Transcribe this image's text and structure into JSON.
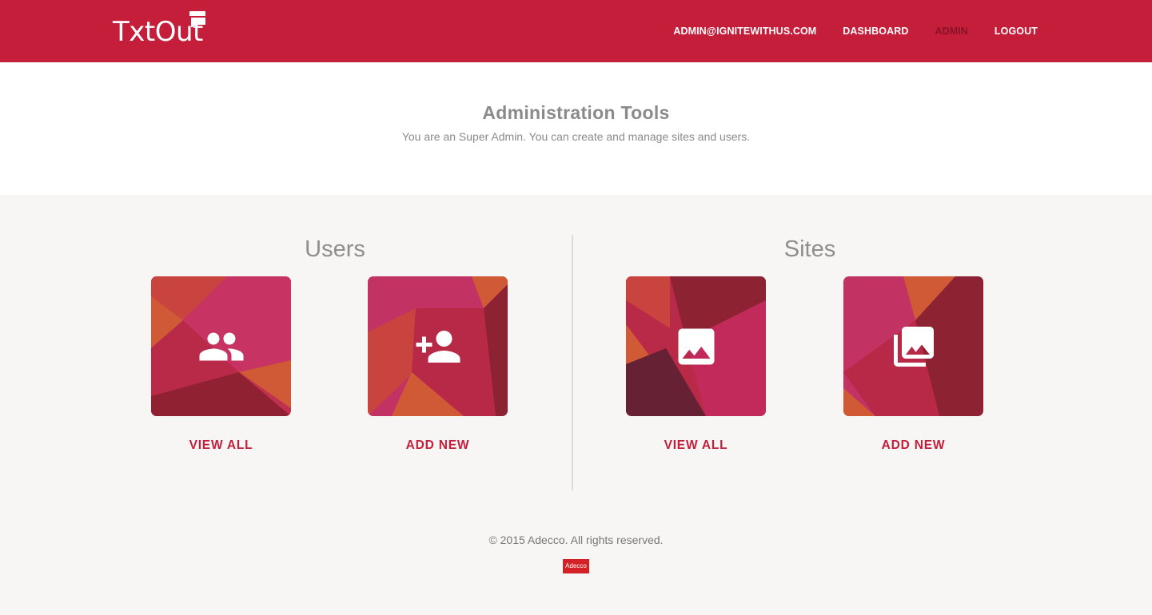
{
  "header": {
    "logo_text": "TxtOut",
    "nav": [
      {
        "label": "ADMIN@IGNITEWITHUS.COM",
        "active": false
      },
      {
        "label": "DASHBOARD",
        "active": false
      },
      {
        "label": "ADMIN",
        "active": true
      },
      {
        "label": "LOGOUT",
        "active": false
      }
    ]
  },
  "intro": {
    "title": "Administration Tools",
    "subtitle": "You are an Super Admin. You can create and manage sites and users."
  },
  "sections": {
    "users": {
      "title": "Users",
      "view_all": {
        "label": "VIEW ALL",
        "icon": "group-icon"
      },
      "add_new": {
        "label": "ADD NEW",
        "icon": "person-add-icon"
      }
    },
    "sites": {
      "title": "Sites",
      "view_all": {
        "label": "VIEW ALL",
        "icon": "image-icon"
      },
      "add_new": {
        "label": "ADD NEW",
        "icon": "photo-library-icon"
      }
    }
  },
  "footer": {
    "copyright": "© 2015 Adecco. All rights reserved.",
    "brand_logo": "Adecco"
  },
  "colors": {
    "brand": "#c41e3a",
    "active_nav": "#8a1227",
    "link": "#c41e3a"
  }
}
